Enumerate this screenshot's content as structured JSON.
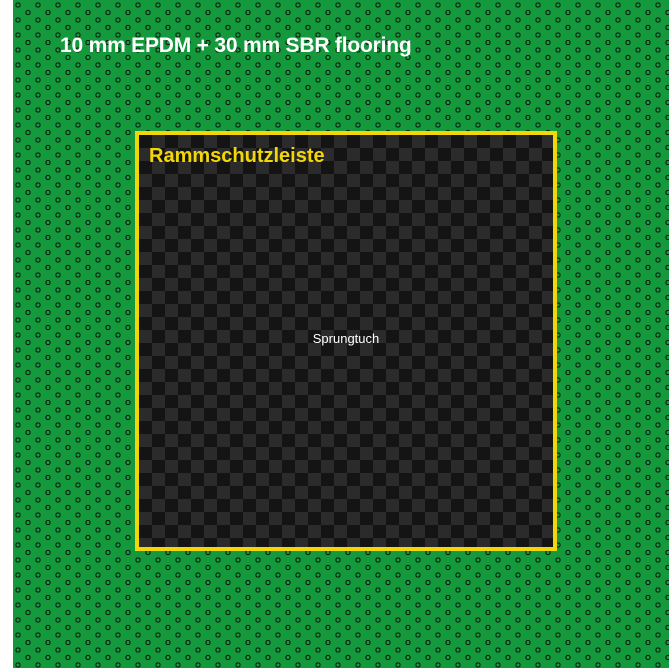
{
  "floor": {
    "title": "10 mm EPDM + 30 mm SBR flooring",
    "color": "#149a3c"
  },
  "frame": {
    "title": "Rammschutzleiste",
    "border_color": "#f2d60a"
  },
  "center": {
    "label": "Sprungtuch"
  }
}
